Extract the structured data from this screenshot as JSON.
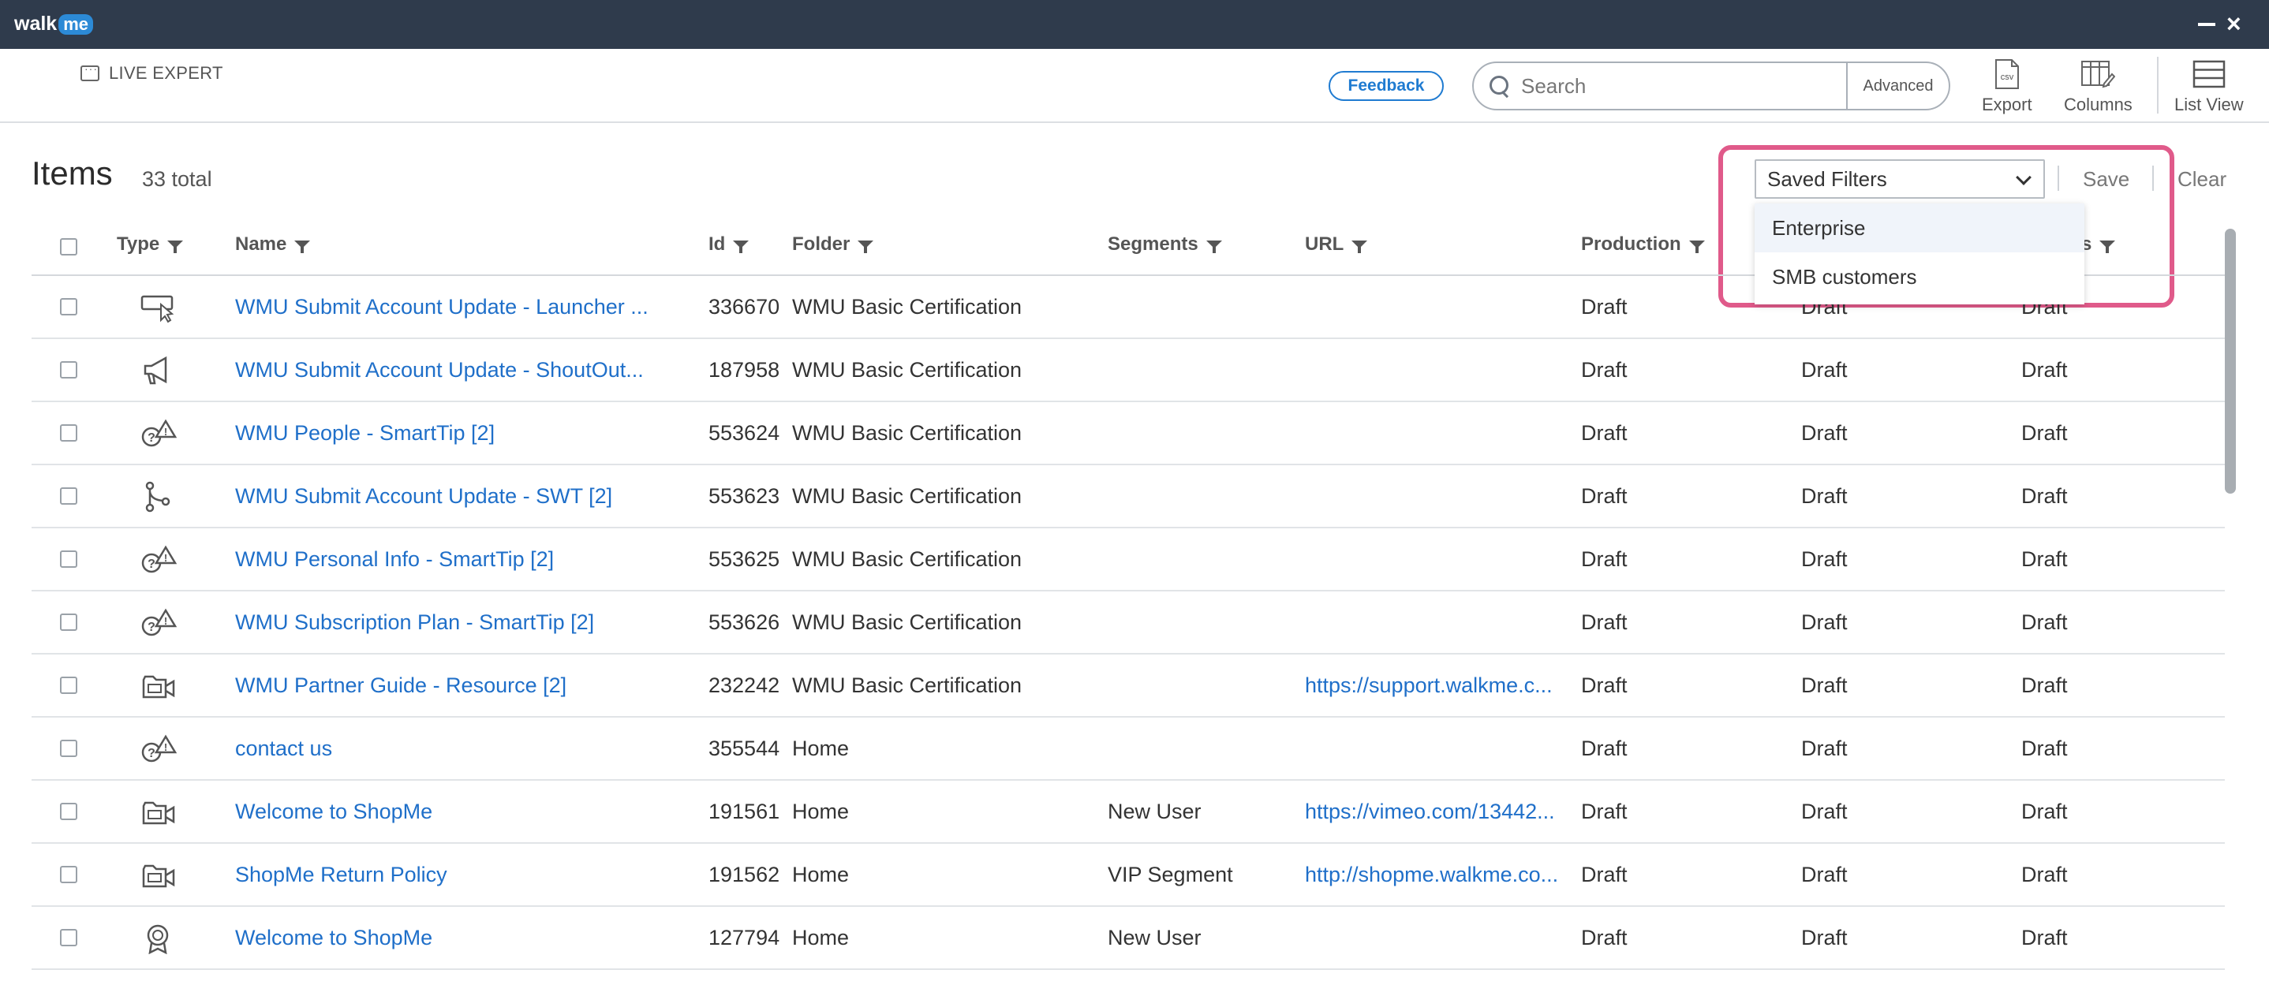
{
  "app": {
    "logo_walk": "walk",
    "logo_me": "me"
  },
  "toolbar": {
    "live_expert": "LIVE EXPERT",
    "feedback": "Feedback",
    "search_placeholder": "Search",
    "advanced": "Advanced",
    "export": "Export",
    "export_badge": "csv",
    "columns": "Columns",
    "list_view": "List View"
  },
  "header": {
    "title": "Items",
    "count": "33 total"
  },
  "filters": {
    "saved_filters": "Saved Filters",
    "options": [
      "Enterprise",
      "SMB customers"
    ],
    "save": "Save",
    "clear": "Clear"
  },
  "table": {
    "columns": {
      "type": "Type",
      "name": "Name",
      "id": "Id",
      "folder": "Folder",
      "segments": "Segments",
      "url": "URL",
      "production": "Production",
      "col8": "s"
    },
    "rows": [
      {
        "icon": "launcher-icon",
        "name": "WMU Submit Account Update - Launcher ...",
        "id": "336670",
        "folder": "WMU Basic Certification",
        "segments": "",
        "url": "",
        "prod": "Draft",
        "c7": "Draft",
        "c8": "Draft"
      },
      {
        "icon": "shoutout-icon",
        "name": "WMU Submit Account Update - ShoutOut...",
        "id": "187958",
        "folder": "WMU Basic Certification",
        "segments": "",
        "url": "",
        "prod": "Draft",
        "c7": "Draft",
        "c8": "Draft"
      },
      {
        "icon": "smarttip-icon",
        "name": "WMU People - SmartTip [2]",
        "id": "553624",
        "folder": "WMU Basic Certification",
        "segments": "",
        "url": "",
        "prod": "Draft",
        "c7": "Draft",
        "c8": "Draft"
      },
      {
        "icon": "smart-walkthru-icon",
        "name": "WMU Submit Account Update - SWT [2]",
        "id": "553623",
        "folder": "WMU Basic Certification",
        "segments": "",
        "url": "",
        "prod": "Draft",
        "c7": "Draft",
        "c8": "Draft"
      },
      {
        "icon": "smarttip-icon",
        "name": "WMU Personal Info - SmartTip [2]",
        "id": "553625",
        "folder": "WMU Basic Certification",
        "segments": "",
        "url": "",
        "prod": "Draft",
        "c7": "Draft",
        "c8": "Draft"
      },
      {
        "icon": "smarttip-icon",
        "name": "WMU Subscription Plan - SmartTip [2]",
        "id": "553626",
        "folder": "WMU Basic Certification",
        "segments": "",
        "url": "",
        "prod": "Draft",
        "c7": "Draft",
        "c8": "Draft"
      },
      {
        "icon": "resource-icon",
        "name": "WMU Partner Guide - Resource [2]",
        "id": "232242",
        "folder": "WMU Basic Certification",
        "segments": "",
        "url": "https://support.walkme.c...",
        "prod": "Draft",
        "c7": "Draft",
        "c8": "Draft"
      },
      {
        "icon": "smarttip-icon",
        "name": "contact us",
        "id": "355544",
        "folder": "Home",
        "segments": "",
        "url": "",
        "prod": "Draft",
        "c7": "Draft",
        "c8": "Draft"
      },
      {
        "icon": "resource-icon",
        "name": "Welcome to ShopMe",
        "id": "191561",
        "folder": "Home",
        "segments": "New User",
        "url": "https://vimeo.com/13442...",
        "prod": "Draft",
        "c7": "Draft",
        "c8": "Draft"
      },
      {
        "icon": "resource-icon",
        "name": "ShopMe Return Policy",
        "id": "191562",
        "folder": "Home",
        "segments": "VIP Segment",
        "url": "http://shopme.walkme.co...",
        "prod": "Draft",
        "c7": "Draft",
        "c8": "Draft"
      },
      {
        "icon": "onboarding-badge-icon",
        "name": "Welcome to ShopMe",
        "id": "127794",
        "folder": "Home",
        "segments": "New User",
        "url": "",
        "prod": "Draft",
        "c7": "Draft",
        "c8": "Draft"
      }
    ]
  }
}
